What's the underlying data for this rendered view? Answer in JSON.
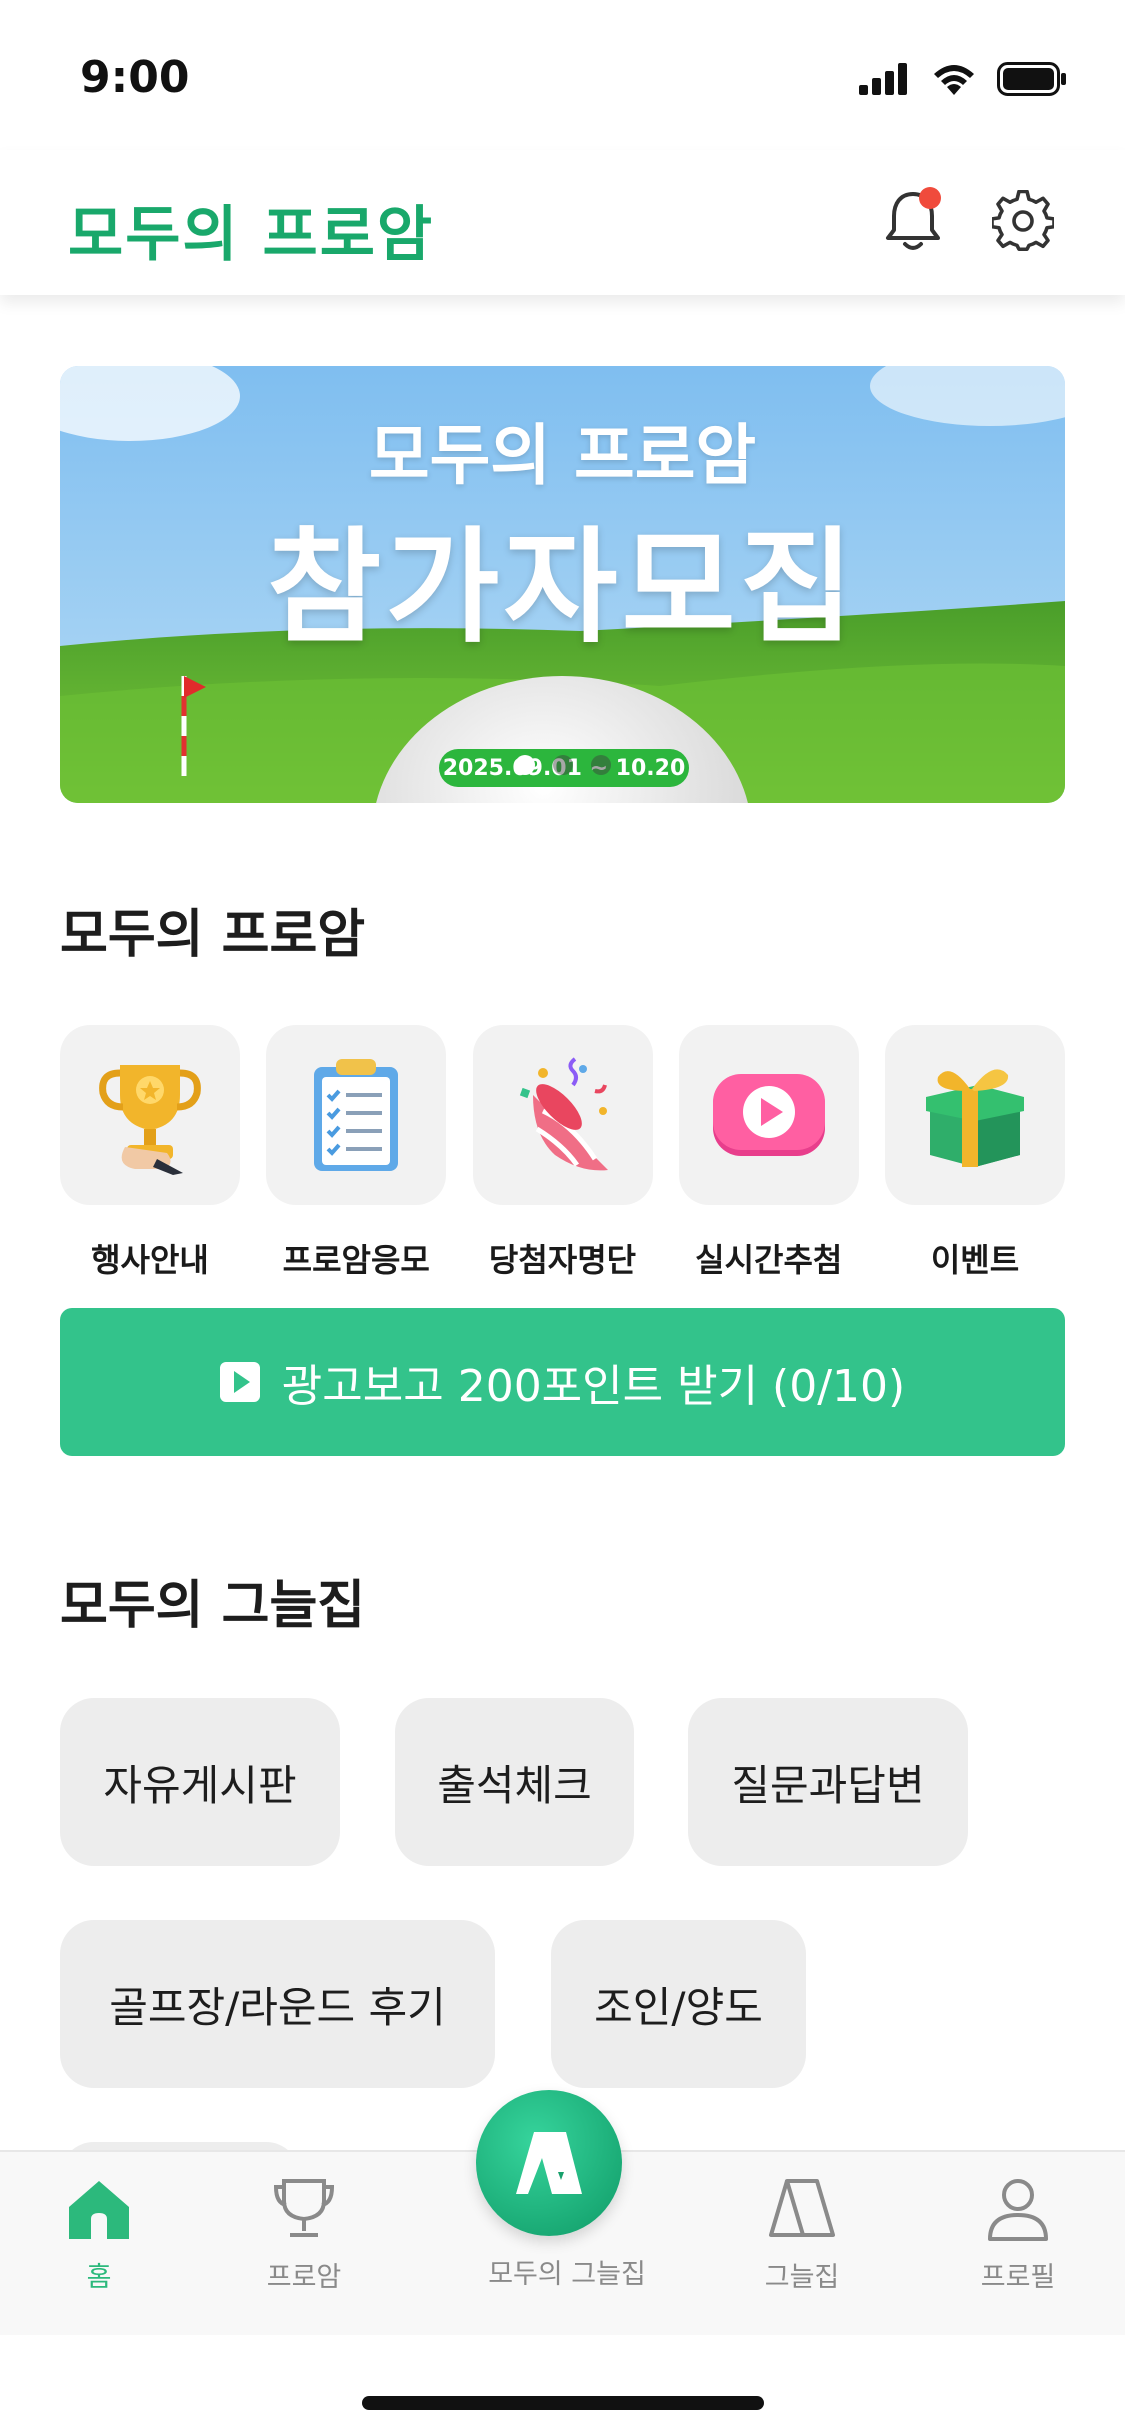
{
  "status": {
    "time": "9:00"
  },
  "header": {
    "logo": "모두의 프로암"
  },
  "banner": {
    "subtitle": "모두의 프로암",
    "title": "참가자모집",
    "date": "2025.09.01 ~ 10.20",
    "pages": 3,
    "active_page": 1
  },
  "proam_section": {
    "title": "모두의 프로암",
    "items": [
      {
        "label": "행사안내",
        "icon": "trophy-icon"
      },
      {
        "label": "프로암응모",
        "icon": "clipboard-icon"
      },
      {
        "label": "당첨자명단",
        "icon": "party-popper-icon"
      },
      {
        "label": "실시간추첨",
        "icon": "play-icon"
      },
      {
        "label": "이벤트",
        "icon": "gift-icon"
      }
    ]
  },
  "ad_button": {
    "label": "광고보고 200포인트 받기 (0/10)"
  },
  "community_section": {
    "title": "모두의 그늘집",
    "chips": [
      "자유게시판",
      "출석체크",
      "질문과답변",
      "골프장/라운드 후기",
      "조인/양도"
    ]
  },
  "tabbar": {
    "active": "홈",
    "tabs": [
      {
        "label": "홈",
        "icon": "home-icon"
      },
      {
        "label": "프로암",
        "icon": "trophy-outline-icon"
      },
      {
        "label": "모두의 그늘집",
        "icon": "shade-house-logo-icon"
      },
      {
        "label": "그늘집",
        "icon": "shade-tent-icon"
      },
      {
        "label": "프로필",
        "icon": "user-icon"
      }
    ]
  },
  "colors": {
    "brand": "#19a86b",
    "accent": "#33c38b",
    "alert": "#f04b3c"
  }
}
